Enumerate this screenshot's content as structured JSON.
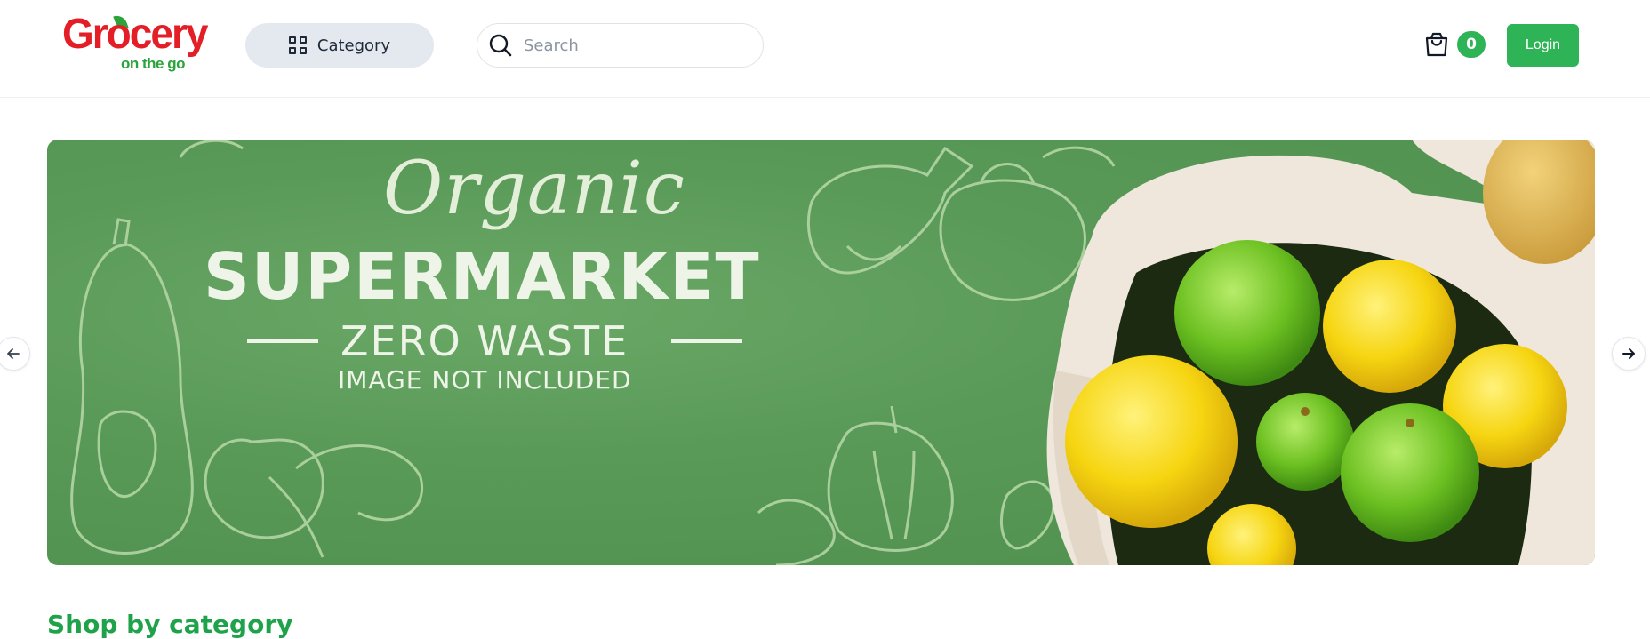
{
  "brand": {
    "name": "Grocery",
    "tagline": "on the go"
  },
  "header": {
    "category_label": "Category",
    "search_placeholder": "Search",
    "cart_count": "0",
    "login_label": "Login"
  },
  "banner": {
    "line1": "Organic",
    "line2": "SUPERMARKET",
    "line3": "ZERO WASTE",
    "line4": "IMAGE NOT INCLUDED"
  },
  "section": {
    "title": "Shop by category"
  },
  "colors": {
    "accent": "#2fb357",
    "brand_red": "#e41e26",
    "banner_green": "#5a9a58",
    "category_bg": "#e4e8ef"
  },
  "icons": {
    "category": "grid-icon",
    "search": "search-icon",
    "cart": "shopping-bag-icon",
    "prev": "arrow-left-icon",
    "next": "arrow-right-icon"
  }
}
